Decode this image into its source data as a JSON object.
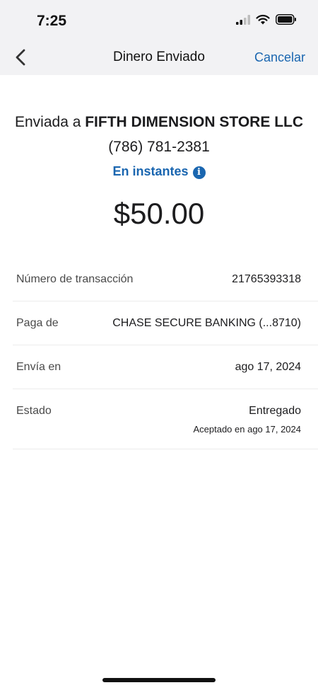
{
  "status_bar": {
    "time": "7:25"
  },
  "nav": {
    "title": "Dinero Enviado",
    "cancel_label": "Cancelar"
  },
  "recipient": {
    "prefix": "Enviada a",
    "name": "FIFTH DIMENSION STORE LLC",
    "phone": "(786) 781-2381"
  },
  "speed": {
    "label": "En instantes",
    "info_glyph": "i"
  },
  "amount": "$50.00",
  "details": [
    {
      "label": "Número de transacción",
      "value": "21765393318"
    },
    {
      "label": "Paga de",
      "value": "CHASE SECURE BANKING (...8710)"
    },
    {
      "label": "Envía en",
      "value": "ago 17, 2024"
    },
    {
      "label": "Estado",
      "value": "Entregado",
      "sub": "Aceptado en ago 17, 2024"
    }
  ],
  "colors": {
    "accent": "#1a66b0",
    "header_bg": "#f2f2f4"
  },
  "icons": {
    "back": "chevron-left-icon",
    "signal": "cellular-signal-icon",
    "wifi": "wifi-icon",
    "battery": "battery-icon",
    "info": "info-icon"
  }
}
